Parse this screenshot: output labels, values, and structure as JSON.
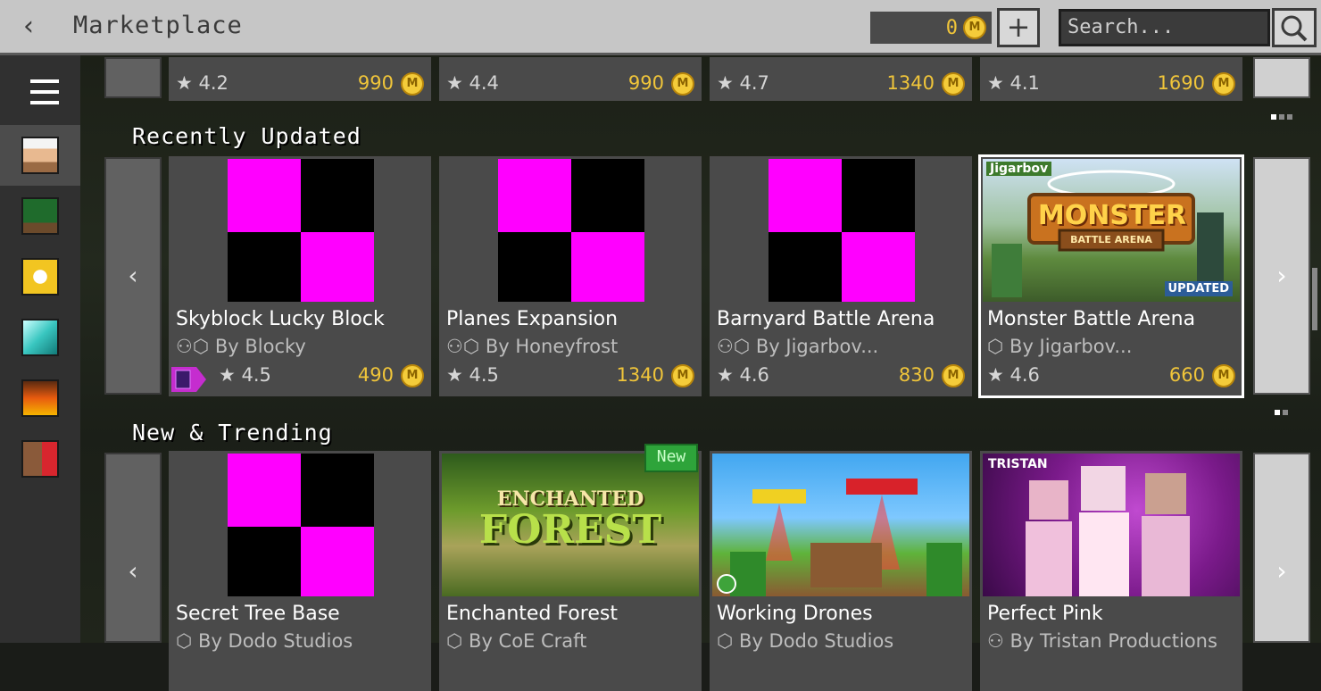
{
  "header": {
    "title": "Marketplace",
    "coin_balance": "0",
    "add_coins_symbol": "+",
    "search_placeholder": "Search..."
  },
  "sidebar": {
    "items": [
      {
        "name": "menu"
      },
      {
        "name": "character-creator",
        "active": true
      },
      {
        "name": "survival-spawns"
      },
      {
        "name": "mashups"
      },
      {
        "name": "diamond-worlds"
      },
      {
        "name": "fire-worlds"
      },
      {
        "name": "villager-favorites"
      }
    ]
  },
  "colors": {
    "accent_gold": "#f0c53a",
    "missing_texture": "#ff00ff",
    "updated_badge": "#2b5caa",
    "new_badge": "#2ea43a"
  },
  "top_row": {
    "cards": [
      {
        "rating": "4.2",
        "price": "990"
      },
      {
        "rating": "4.4",
        "price": "990"
      },
      {
        "rating": "4.7",
        "price": "1340"
      },
      {
        "rating": "4.1",
        "price": "1690"
      }
    ]
  },
  "sections": {
    "recently_updated": {
      "title": "Recently Updated",
      "cards": [
        {
          "title": "Skyblock Lucky Block",
          "author": "By Blocky",
          "rating": "4.5",
          "price": "490"
        },
        {
          "title": "Planes Expansion",
          "author": "By Honeyfrost",
          "rating": "4.5",
          "price": "1340"
        },
        {
          "title": "Barnyard Battle Arena",
          "author": "By Jigarbov...",
          "rating": "4.6",
          "price": "830"
        },
        {
          "title": "Monster Battle Arena",
          "author": "By Jigarbov...",
          "rating": "4.6",
          "price": "660",
          "badge": "UPDATED",
          "art_text": "MONSTER",
          "art_subtext": "BATTLE ARENA",
          "brand": "Jigarbov"
        }
      ]
    },
    "new_trending": {
      "title": "New & Trending",
      "new_badge": "New",
      "cards": [
        {
          "title": "Secret Tree Base",
          "author": "By Dodo Studios"
        },
        {
          "title": "Enchanted Forest",
          "author": "By CoE Craft",
          "art_text": "ENCHANTED",
          "art_subtext": "FOREST"
        },
        {
          "title": "Working Drones",
          "author": "By Dodo Studios"
        },
        {
          "title": "Perfect Pink",
          "author": "By Tristan Productions",
          "brand": "TRISTAN"
        }
      ]
    }
  },
  "icons": {
    "back": "‹",
    "star": "★",
    "coin": "M",
    "prev": "‹",
    "next": "›"
  }
}
